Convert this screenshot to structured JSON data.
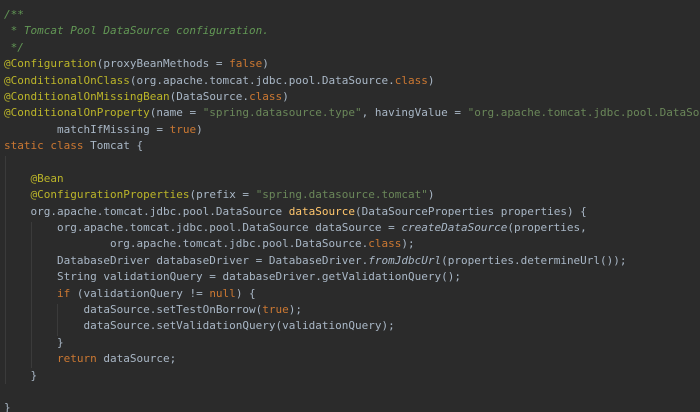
{
  "editor": {
    "colors": {
      "background": "#2b2b2b",
      "text": "#a9b7c6",
      "keyword": "#cc7832",
      "string": "#6a8759",
      "annotation": "#bbb529",
      "doc_comment": "#629755",
      "method_declaration": "#ffc66d"
    },
    "lines": [
      [
        {
          "t": "/**",
          "c": "comment"
        }
      ],
      [
        {
          "t": " * Tomcat Pool DataSource configuration.",
          "c": "comment"
        }
      ],
      [
        {
          "t": " */",
          "c": "comment"
        }
      ],
      [
        {
          "t": "@Configuration",
          "c": "annotation"
        },
        {
          "t": "(proxyBeanMethods = "
        },
        {
          "t": "false",
          "c": "keyword"
        },
        {
          "t": ")"
        }
      ],
      [
        {
          "t": "@ConditionalOnClass",
          "c": "annotation"
        },
        {
          "t": "(org.apache.tomcat.jdbc.pool.DataSource."
        },
        {
          "t": "class",
          "c": "keyword"
        },
        {
          "t": ")"
        }
      ],
      [
        {
          "t": "@ConditionalOnMissingBean",
          "c": "annotation"
        },
        {
          "t": "(DataSource."
        },
        {
          "t": "class",
          "c": "keyword"
        },
        {
          "t": ")"
        }
      ],
      [
        {
          "t": "@ConditionalOnProperty",
          "c": "annotation"
        },
        {
          "t": "(name = "
        },
        {
          "t": "\"spring.datasource.type\"",
          "c": "string"
        },
        {
          "t": ", havingValue = "
        },
        {
          "t": "\"org.apache.tomcat.jdbc.pool.DataSource\"",
          "c": "string"
        },
        {
          "t": ","
        }
      ],
      [
        {
          "t": "        matchIfMissing = "
        },
        {
          "t": "true",
          "c": "keyword"
        },
        {
          "t": ")"
        }
      ],
      [
        {
          "t": "static class ",
          "c": "keyword"
        },
        {
          "t": "Tomcat {"
        }
      ],
      [
        {
          "t": ""
        }
      ],
      [
        {
          "t": "    "
        },
        {
          "t": "@Bean",
          "c": "annotation"
        }
      ],
      [
        {
          "t": "    "
        },
        {
          "t": "@ConfigurationProperties",
          "c": "annotation"
        },
        {
          "t": "(prefix = "
        },
        {
          "t": "\"spring.datasource.tomcat\"",
          "c": "string"
        },
        {
          "t": ")"
        }
      ],
      [
        {
          "t": "    org.apache.tomcat.jdbc.pool.DataSource "
        },
        {
          "t": "dataSource",
          "c": "method-decl"
        },
        {
          "t": "(DataSourceProperties properties) {"
        }
      ],
      [
        {
          "t": "        org.apache.tomcat.jdbc.pool.DataSource dataSource = "
        },
        {
          "t": "createDataSource",
          "c": "static-call"
        },
        {
          "t": "(properties,"
        }
      ],
      [
        {
          "t": "                org.apache.tomcat.jdbc.pool.DataSource."
        },
        {
          "t": "class",
          "c": "keyword"
        },
        {
          "t": ");"
        }
      ],
      [
        {
          "t": "        DatabaseDriver databaseDriver = DatabaseDriver."
        },
        {
          "t": "fromJdbcUrl",
          "c": "static-call"
        },
        {
          "t": "(properties.determineUrl());"
        }
      ],
      [
        {
          "t": "        String validationQuery = databaseDriver.getValidationQuery();"
        }
      ],
      [
        {
          "t": "        "
        },
        {
          "t": "if ",
          "c": "keyword"
        },
        {
          "t": "(validationQuery != "
        },
        {
          "t": "null",
          "c": "keyword"
        },
        {
          "t": ") {"
        }
      ],
      [
        {
          "t": "            dataSource.setTestOnBorrow("
        },
        {
          "t": "true",
          "c": "keyword"
        },
        {
          "t": ");"
        }
      ],
      [
        {
          "t": "            dataSource.setValidationQuery(validationQuery);"
        }
      ],
      [
        {
          "t": "        }"
        }
      ],
      [
        {
          "t": "        "
        },
        {
          "t": "return ",
          "c": "keyword"
        },
        {
          "t": "dataSource;"
        }
      ],
      [
        {
          "t": "    }"
        }
      ],
      [
        {
          "t": ""
        }
      ],
      [
        {
          "t": "}"
        }
      ]
    ]
  }
}
